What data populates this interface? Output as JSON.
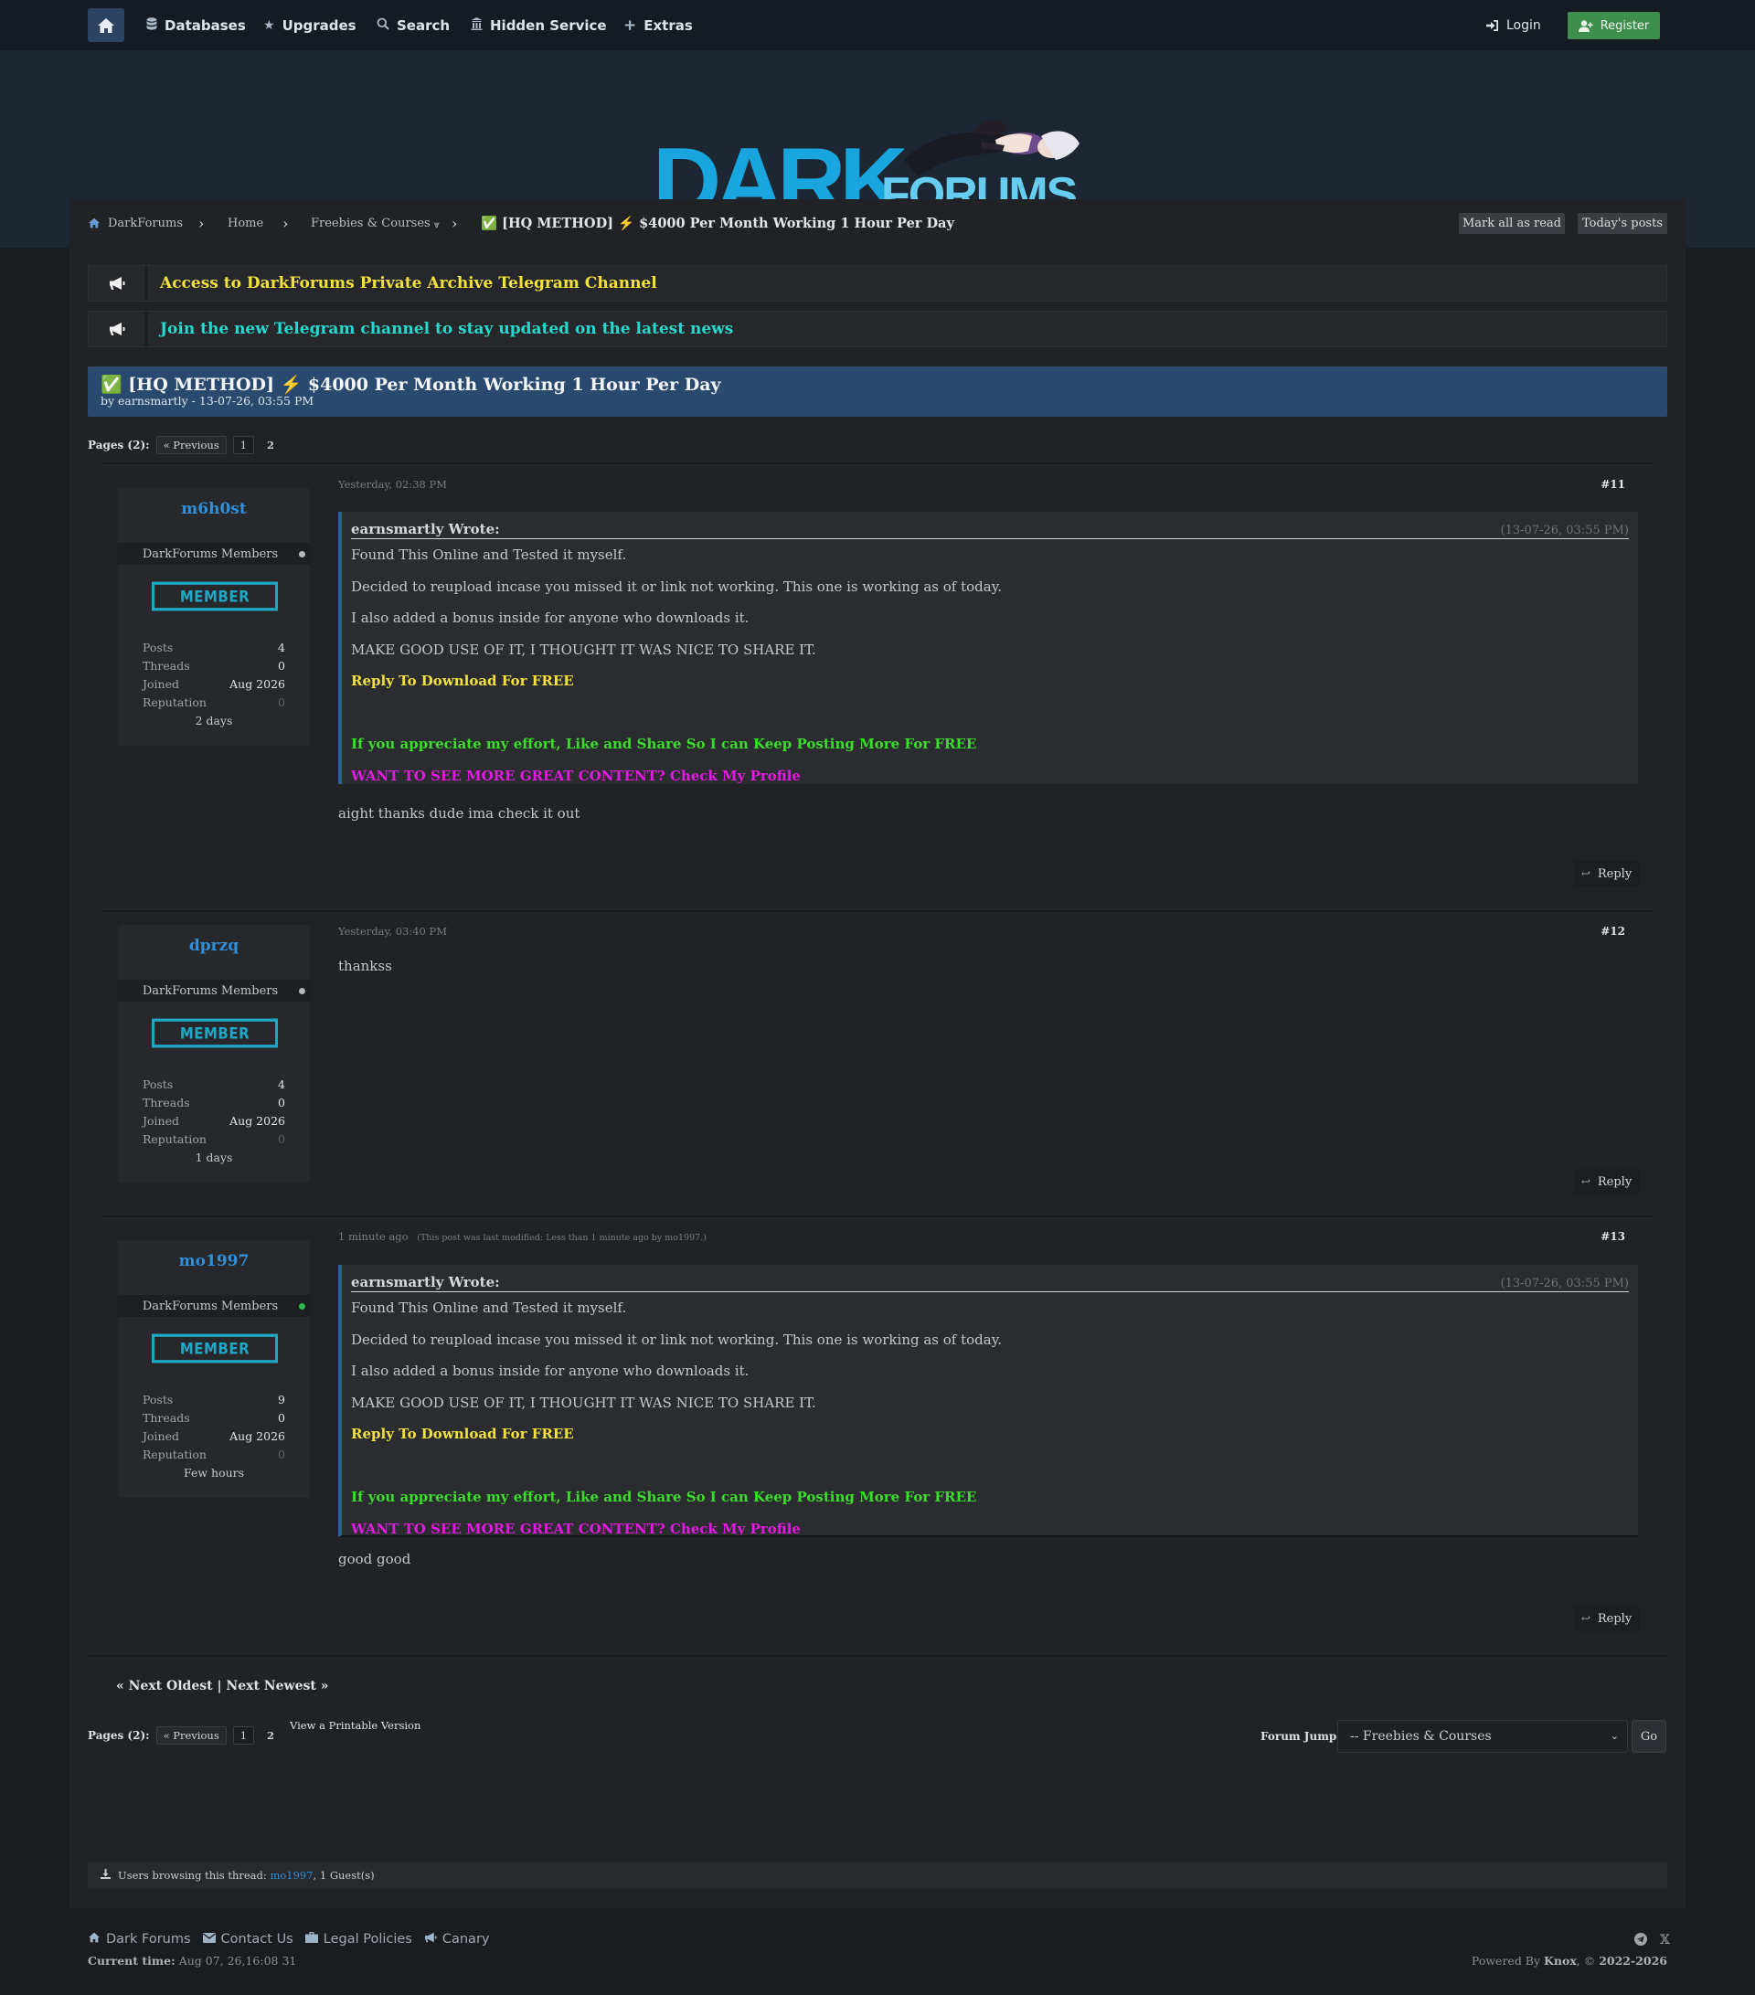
{
  "nav": {
    "items": [
      {
        "icon": "database-icon",
        "label": "Databases"
      },
      {
        "icon": "star-icon",
        "label": "Upgrades"
      },
      {
        "icon": "search-icon",
        "label": "Search"
      },
      {
        "icon": "building-icon",
        "label": "Hidden Service"
      },
      {
        "icon": "plus-icon",
        "label": "Extras"
      }
    ],
    "login": "Login",
    "register": "Register"
  },
  "logo": {
    "dark": "DARK",
    "forums": "FORUMS"
  },
  "breadcrumb": {
    "items": [
      "DarkForums",
      "Home",
      "Freebies & Courses",
      "✅ [HQ METHOD] ⚡ $4000 Per Month Working 1 Hour Per Day"
    ],
    "dropdown_glyph": "⩔",
    "mark_all_read": "Mark all as read",
    "todays_posts": "Today's posts"
  },
  "announcements": [
    {
      "text": "Access to DarkForums Private Archive Telegram Channel",
      "color": "#f3e23a"
    },
    {
      "text": "Join the new Telegram channel to stay updated on the latest news",
      "color": "#25d9cf"
    }
  ],
  "thread": {
    "title": "✅ [HQ METHOD] ⚡ $4000 Per Month Working 1 Hour Per Day",
    "meta": "by earnsmartly - 13-07-26, 03:55 PM"
  },
  "pagination": {
    "label": "Pages (2):",
    "previous": "« Previous",
    "pages": [
      "1",
      "2"
    ]
  },
  "quote": {
    "author": "earnsmartly Wrote:",
    "date": "(13-07-26, 03:55 PM)",
    "lines": [
      "Found This Online and Tested it myself.",
      "Decided to reupload incase you missed it or link not working. This one is working as of today.",
      "I also added a bonus inside for anyone who downloads it.",
      "MAKE GOOD USE OF IT, I THOUGHT IT WAS NICE TO SHARE IT."
    ],
    "download": "Reply To Download For FREE",
    "appreciate": "If you appreciate my effort, Like and Share So I can Keep Posting More For FREE",
    "profile": "WANT TO SEE MORE GREAT CONTENT? Check My Profile"
  },
  "posts": [
    {
      "username": "m6h0st",
      "group": "DarkForums Members",
      "badge": "MEMBER",
      "posts_label": "Posts",
      "posts": "4",
      "threads_label": "Threads",
      "threads": "0",
      "joined_label": "Joined",
      "joined": "Aug 2026",
      "rep_label": "Reputation",
      "rep": "0",
      "since": "2 days",
      "date": "Yesterday, 02:38 PM",
      "edit": "",
      "number": "#11",
      "message": "aight thanks dude ima check it out",
      "reply": "Reply",
      "online": false
    },
    {
      "username": "dprzq",
      "group": "DarkForums Members",
      "badge": "MEMBER",
      "posts_label": "Posts",
      "posts": "4",
      "threads_label": "Threads",
      "threads": "0",
      "joined_label": "Joined",
      "joined": "Aug 2026",
      "rep_label": "Reputation",
      "rep": "0",
      "since": "1 days",
      "date": "Yesterday, 03:40 PM",
      "edit": "",
      "number": "#12",
      "message": "thankss",
      "reply": "Reply",
      "online": false
    },
    {
      "username": "mo1997",
      "group": "DarkForums Members",
      "badge": "MEMBER",
      "posts_label": "Posts",
      "posts": "9",
      "threads_label": "Threads",
      "threads": "0",
      "joined_label": "Joined",
      "joined": "Aug 2026",
      "rep_label": "Reputation",
      "rep": "0",
      "since": "Few hours",
      "date": "1 minute ago",
      "edit": "(This post was last modified: Less than 1 minute ago by mo1997.)",
      "number": "#13",
      "message": "good good",
      "reply": "Reply",
      "online": true
    }
  ],
  "thread_nav": "« Next Oldest | Next Newest »",
  "printable": "View a Printable Version",
  "forum_jump": {
    "label": "Forum Jump:",
    "selected": "-- Freebies & Courses",
    "go": "Go"
  },
  "browsing": {
    "prefix": "Users browsing this thread:",
    "user": "mo1997",
    "suffix": ", 1 Guest(s)"
  },
  "footer": {
    "links": [
      {
        "icon": "home-icon",
        "label": "Dark Forums"
      },
      {
        "icon": "envelope-icon",
        "label": "Contact Us"
      },
      {
        "icon": "briefcase-icon",
        "label": "Legal Policies"
      },
      {
        "icon": "megaphone-icon",
        "label": "Canary"
      }
    ],
    "current_time_label": "Current time:",
    "current_time": "Aug 07, 26,16:08 31",
    "powered_prefix": "Powered By",
    "powered_name": "Knox",
    "powered_suffix": ", ©",
    "powered_years": "2022-2026"
  }
}
